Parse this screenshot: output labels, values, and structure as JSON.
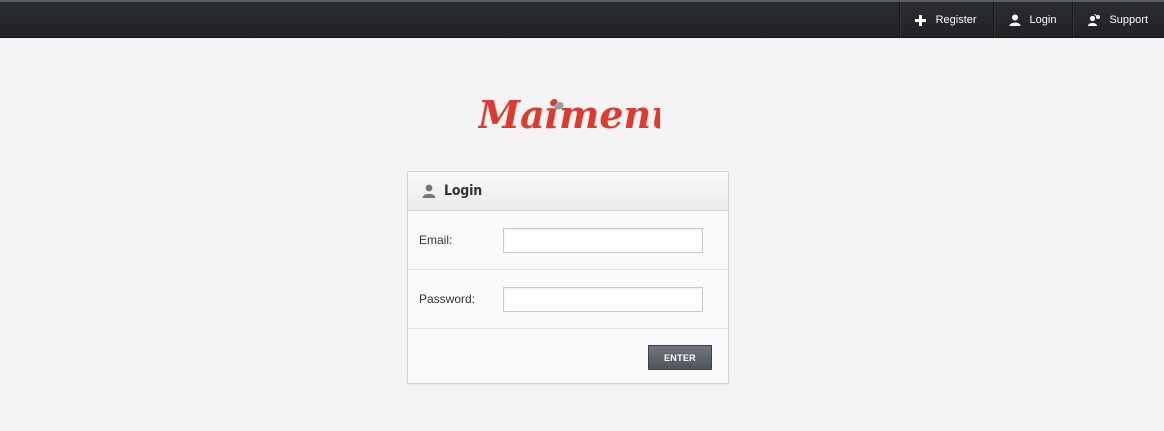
{
  "nav": {
    "items": [
      {
        "label": "Register",
        "icon": "plus-icon"
      },
      {
        "label": "Login",
        "icon": "user-icon"
      },
      {
        "label": "Support",
        "icon": "support-icon"
      }
    ]
  },
  "logo": {
    "text": "Maimenu",
    "color": "#e03a2f"
  },
  "login": {
    "title": "Login",
    "email_label": "Email:",
    "email_value": "",
    "password_label": "Password:",
    "password_value": "",
    "enter_label": "ENTER"
  }
}
